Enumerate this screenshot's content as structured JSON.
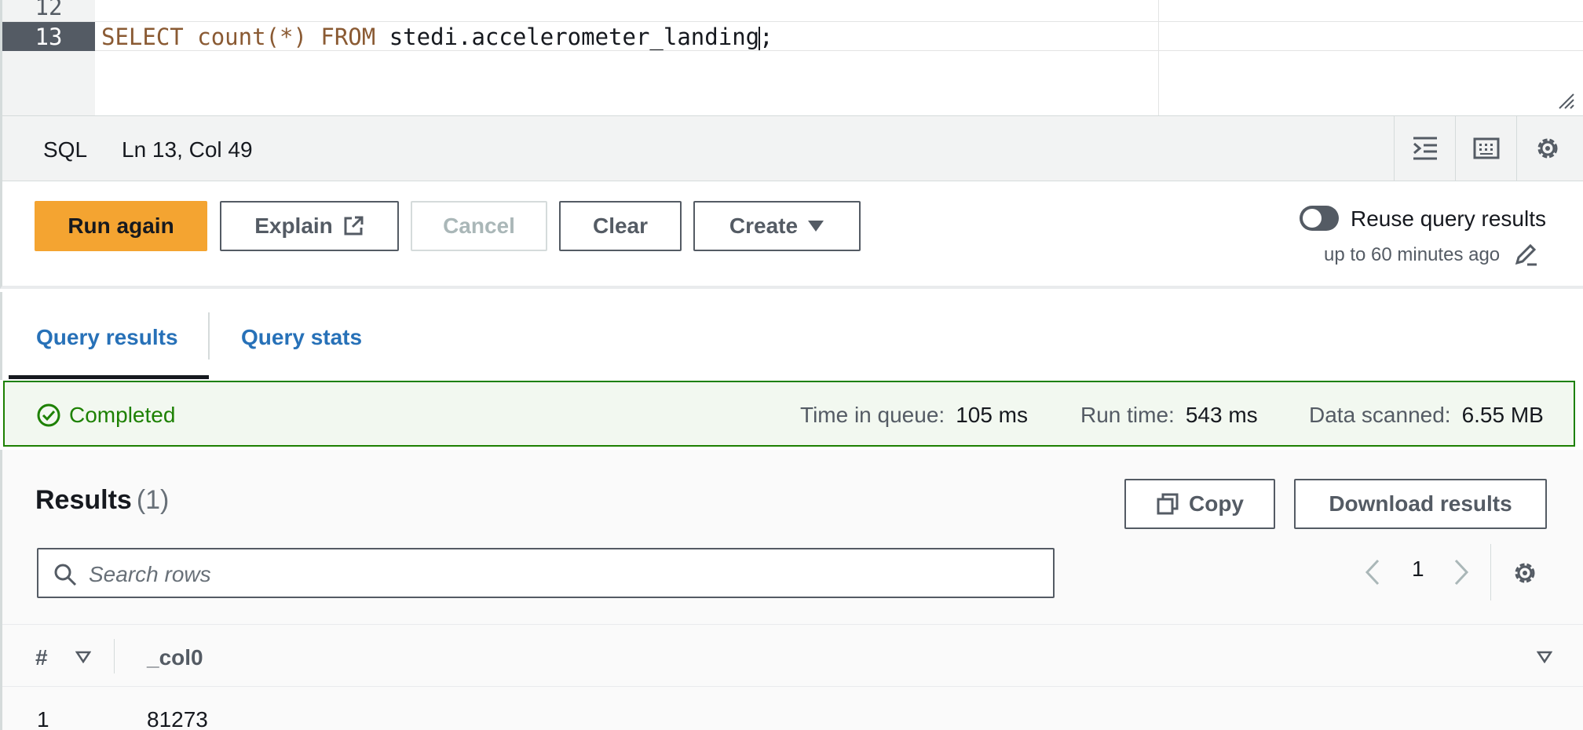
{
  "editor": {
    "lines": [
      {
        "number": "12",
        "code": ""
      },
      {
        "number": "13",
        "kw1": "SELECT",
        "fn": "count(*)",
        "kw2": "FROM",
        "rest_before_cursor": "stedi.accelerometer_landing",
        "rest_after_cursor": ";"
      }
    ]
  },
  "statusbar": {
    "language": "SQL",
    "cursor_position": "Ln 13, Col 49",
    "tools": [
      "indent-icon",
      "keyboard-icon",
      "settings-icon"
    ]
  },
  "actions": {
    "run_again": "Run again",
    "explain": "Explain",
    "cancel": "Cancel",
    "clear": "Clear",
    "create": "Create",
    "reuse_label": "Reuse query results",
    "reuse_sub": "up to 60 minutes ago",
    "reuse_enabled": false
  },
  "tabs": {
    "query_results": "Query results",
    "query_stats": "Query stats",
    "active": "Query results"
  },
  "banner": {
    "status": "Completed",
    "time_in_queue_label": "Time in queue:",
    "time_in_queue": "105 ms",
    "run_time_label": "Run time:",
    "run_time": "543 ms",
    "data_scanned_label": "Data scanned:",
    "data_scanned": "6.55 MB"
  },
  "results": {
    "title": "Results",
    "count": "(1)",
    "copy": "Copy",
    "download": "Download results",
    "search_placeholder": "Search rows",
    "page": "1",
    "columns": [
      "#",
      "_col0"
    ],
    "rows": [
      [
        "1",
        "81273"
      ]
    ]
  },
  "colors": {
    "primary": "#f4a431",
    "link": "#2771b8",
    "success": "#1d8102",
    "text": "#16191f",
    "muted": "#545b64"
  }
}
